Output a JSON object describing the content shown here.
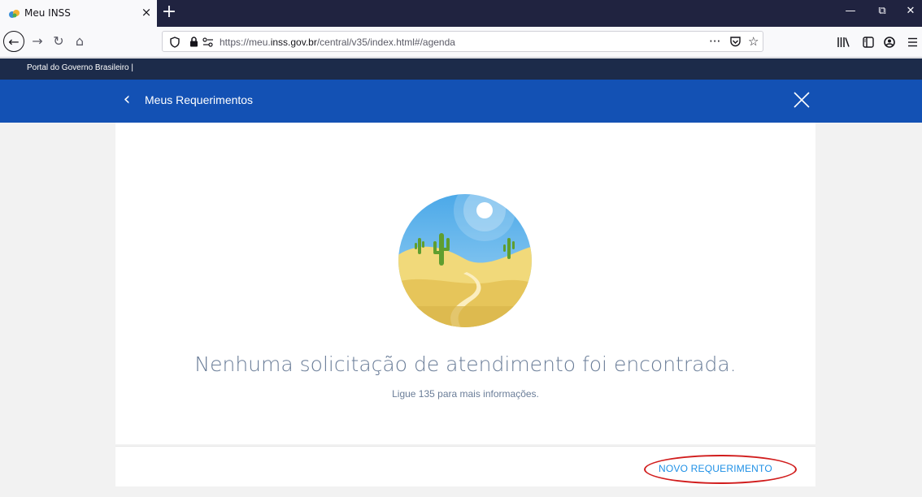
{
  "browser": {
    "tab_title": "Meu INSS",
    "tab_close": "×",
    "new_tab": "+",
    "window_minimize": "—",
    "window_restore": "⧉",
    "window_close": "✕",
    "url_prefix": "https://meu.",
    "url_domain": "inss.gov.br",
    "url_path": "/central/v35/index.html#/agenda",
    "icons": [
      "back-icon",
      "forward-icon",
      "reload-icon",
      "home-icon",
      "shield-icon",
      "lock-icon",
      "permissions-icon",
      "page-actions-icon",
      "pocket-icon",
      "bookmark-star-icon",
      "library-icon",
      "sidebar-icon",
      "account-icon",
      "menu-icon"
    ]
  },
  "govbar": {
    "text": "Portal do Governo Brasileiro  |"
  },
  "header": {
    "back": "‹",
    "title": "Meus Requerimentos",
    "bg_color": "#1351b4"
  },
  "empty_state": {
    "title": "Nenhuma solicitação de atendimento foi encontrada.",
    "subtitle": "Ligue 135 para mais informações."
  },
  "footer": {
    "new_request_label": "NOVO REQUERIMENTO",
    "link_color": "#1e90e6",
    "highlight_color": "#d11d1d"
  }
}
